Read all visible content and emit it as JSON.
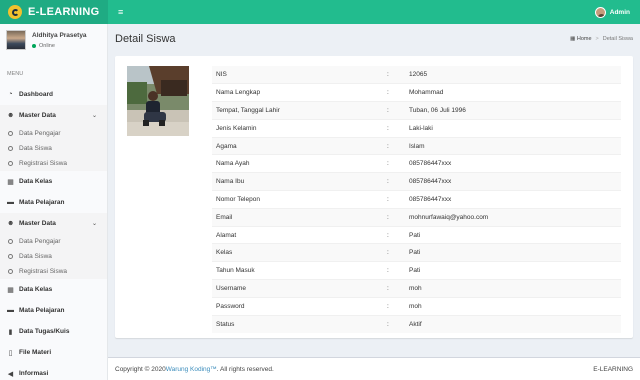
{
  "app": {
    "logo_text": "E-LEARNING",
    "accent": "#22bc8e",
    "logo_bg": "#1fab83"
  },
  "topbar": {
    "menu_toggle": "≡",
    "user_name": "Admin"
  },
  "user_panel": {
    "name": "Aldhitya Prasetya",
    "status": "Online"
  },
  "sidebar": {
    "menu_header": "MENU",
    "dashboard": "Dashboard",
    "group1": {
      "label": "Master Data",
      "items": [
        "Data Pengajar",
        "Data Siswa",
        "Registrasi Siswa"
      ]
    },
    "data_kelas_1": "Data Kelas",
    "mata_pelajaran_1": "Mata Pelajaran",
    "group2": {
      "label": "Master Data",
      "items": [
        "Data Pengajar",
        "Data Siswa",
        "Registrasi Siswa"
      ]
    },
    "data_kelas_2": "Data Kelas",
    "mata_pelajaran_2": "Mata Pelajaran",
    "data_tugas": "Data Tugas/Kuis",
    "file_materi": "File Materi",
    "informasi": "Informasi"
  },
  "header": {
    "title": "Detail Siswa",
    "breadcrumb_home": "Home",
    "breadcrumb_sep": ">",
    "breadcrumb_current": "Detail Siswa"
  },
  "detail": {
    "colon": ":",
    "rows": [
      {
        "label": "NIS",
        "value": "12065"
      },
      {
        "label": "Nama Lengkap",
        "value": "Mohammad"
      },
      {
        "label": "Tempat, Tanggal Lahir",
        "value": "Tuban, 06 Juli 1996"
      },
      {
        "label": "Jenis Kelamin",
        "value": "Laki-laki"
      },
      {
        "label": "Agama",
        "value": "Islam"
      },
      {
        "label": "Nama Ayah",
        "value": "085786447xxx"
      },
      {
        "label": "Nama Ibu",
        "value": "085786447xxx"
      },
      {
        "label": "Nomor Telepon",
        "value": "085786447xxx"
      },
      {
        "label": "Email",
        "value": "mohnurfawaiq@yahoo.com"
      },
      {
        "label": "Alamat",
        "value": "Pati"
      },
      {
        "label": "Kelas",
        "value": "Pati"
      },
      {
        "label": "Tahun Masuk",
        "value": "Pati"
      },
      {
        "label": "Username",
        "value": "moh"
      },
      {
        "label": "Password",
        "value": "moh"
      },
      {
        "label": "Status",
        "value": "Aktif"
      }
    ]
  },
  "footer": {
    "copyright_prefix": "Copyright © 2020 ",
    "link_text": "Warung Koding™",
    "copyright_suffix": ". All rights reserved.",
    "brand": "E-LEARNING"
  }
}
